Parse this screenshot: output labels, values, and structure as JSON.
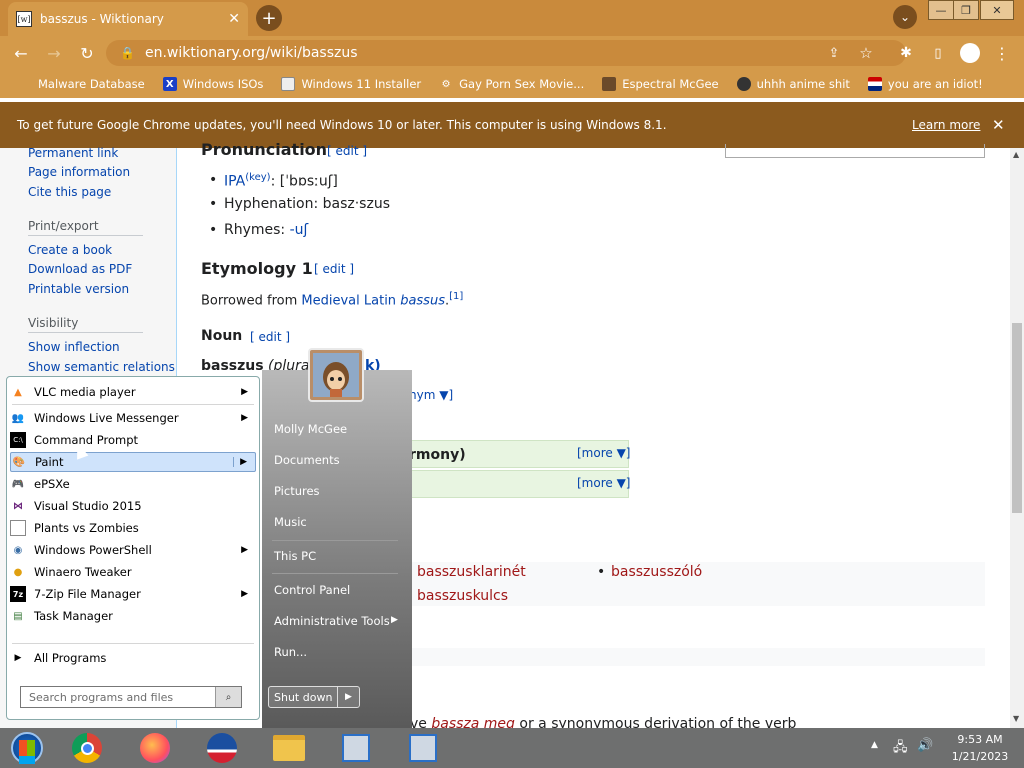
{
  "browser": {
    "tab_title": "basszus - Wiktionary",
    "tab_favicon": "[w]",
    "url": "en.wiktionary.org/wiki/basszus",
    "bookmarks": [
      {
        "label": "Malware Database",
        "icon": "blank-page-icon"
      },
      {
        "label": "Windows ISOs",
        "icon": "x-logo-icon"
      },
      {
        "label": "Windows 11 Installer",
        "icon": "image-icon"
      },
      {
        "label": "Gay Porn Sex Movie...",
        "icon": "gear-icon"
      },
      {
        "label": "Espectral McGee",
        "icon": "avatar-icon"
      },
      {
        "label": "uhhh anime shit",
        "icon": "anime-icon"
      },
      {
        "label": "you are an idiot!",
        "icon": "flag-icon"
      }
    ],
    "infobar": {
      "message": "To get future Google Chrome updates, you'll need Windows 10 or later. This computer is using Windows 8.1.",
      "learn_more": "Learn more"
    }
  },
  "sidebar": {
    "links_top": [
      "Permanent link",
      "Page information",
      "Cite this page"
    ],
    "print_heading": "Print/export",
    "print_links": [
      "Create a book",
      "Download as PDF",
      "Printable version"
    ],
    "visibility_heading": "Visibility",
    "visibility_links": [
      "Show inflection",
      "Show semantic relations"
    ]
  },
  "article": {
    "pronunciation_heading": "Pronunciation",
    "edit": "[ edit ]",
    "ipa_label": "IPA",
    "ipa_key": "(key)",
    "ipa_value": ": [ˈbɒsːuʃ]",
    "hyphenation": "Hyphenation: basz‧szus",
    "rhymes_label": "Rhymes: ",
    "rhymes_value": "-uʃ",
    "etymology_heading": "Etymology 1",
    "etymology_prefix": "Borrowed from ",
    "etymology_lang": "Medieval Latin",
    "etymology_word": "bassus",
    "etymology_ref": "[1]",
    "noun_heading": "Noun",
    "headword": "basszus",
    "plural_label": "(plural",
    "plural_word_partial": "b",
    "plural_partial_end": "k)",
    "synonym_partial": "nym ▼]",
    "box1_text": "rmony)",
    "more1": "[more ▼]",
    "more2": "[more ▼]",
    "compounds": [
      "basszusklarinét",
      "basszuskulcs",
      "basszusszóló"
    ],
    "bottom_partial_1": "ve ",
    "bottom_partial_link": "bassza meg",
    "bottom_partial_2": " or a synonymous derivation of the verb"
  },
  "startmenu": {
    "programs": [
      {
        "label": "VLC media player",
        "icon": "vlc-cone-icon",
        "arrow": true
      },
      {
        "label": "Windows Live Messenger",
        "icon": "messenger-icon",
        "arrow": true
      },
      {
        "label": "Command Prompt",
        "icon": "cmd-icon",
        "arrow": false
      },
      {
        "label": "Paint",
        "icon": "paint-palette-icon",
        "arrow": true,
        "selected": true
      },
      {
        "label": "ePSXe",
        "icon": "gamepad-icon",
        "arrow": false
      },
      {
        "label": "Visual Studio 2015",
        "icon": "visual-studio-icon",
        "arrow": false
      },
      {
        "label": "Plants vs Zombies",
        "icon": "document-icon",
        "arrow": false
      },
      {
        "label": "Windows PowerShell",
        "icon": "powershell-icon",
        "arrow": true
      },
      {
        "label": "Winaero Tweaker",
        "icon": "winaero-icon",
        "arrow": false
      },
      {
        "label": "7-Zip File Manager",
        "icon": "7zip-icon",
        "arrow": true
      },
      {
        "label": "Task Manager",
        "icon": "task-manager-icon",
        "arrow": false
      }
    ],
    "all_programs": "All Programs",
    "search_placeholder": "Search programs and files",
    "right_links": [
      "Molly McGee",
      "Documents",
      "Pictures",
      "Music",
      "This PC",
      "Control Panel",
      "Administrative Tools",
      "Run..."
    ],
    "shutdown": "Shut down"
  },
  "taskbar": {
    "items": [
      "start-orb-icon",
      "chrome-icon",
      "firefox-icon",
      "obama-logo-icon",
      "file-explorer-icon",
      "network-setup-icon",
      "network-setup-icon"
    ],
    "time": "9:53 AM",
    "date": "1/21/2023"
  },
  "colors": {
    "chrome_theme": "#d49a4a",
    "infobar": "#8b5a1e",
    "wiki_link": "#0645ad",
    "wiki_redlink": "#a01818",
    "taskbar": "#6e6f6f"
  }
}
